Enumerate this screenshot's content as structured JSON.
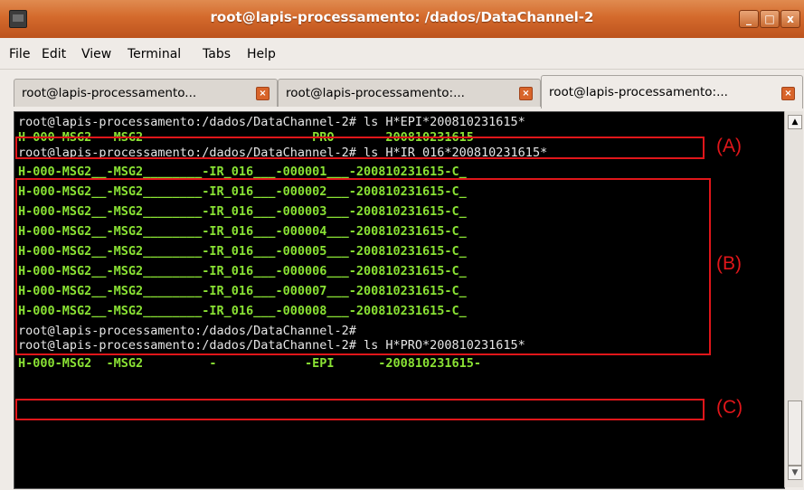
{
  "window": {
    "title": "root@lapis-processamento: /dados/DataChannel-2",
    "controls": {
      "minimize": "_",
      "maximize": "□",
      "close": "x"
    }
  },
  "menu": [
    {
      "label": "File"
    },
    {
      "label": "Edit"
    },
    {
      "label": "View"
    },
    {
      "label": "Terminal"
    },
    {
      "label": "Tabs"
    },
    {
      "label": "Help"
    }
  ],
  "tabs": [
    {
      "label": "root@lapis-processamento...",
      "active": false
    },
    {
      "label": "root@lapis-processamento:...",
      "active": false
    },
    {
      "label": "root@lapis-processamento:...",
      "active": true
    }
  ],
  "terminal": {
    "lines": [
      {
        "type": "prompt",
        "text": "root@lapis-processamento:/dados/DataChannel-2# ls H*EPI*200810231615*"
      },
      {
        "type": "output",
        "text": "H-000-MSG2  -MSG2         -            -PRO      -200810231615-"
      },
      {
        "type": "prompt",
        "text": "root@lapis-processamento:/dados/DataChannel-2# ls H*IR_016*200810231615*"
      },
      {
        "type": "output",
        "text": "H-000-MSG2__-MSG2________-IR_016___-000001___-200810231615-C_"
      },
      {
        "type": "output",
        "text": "H-000-MSG2__-MSG2________-IR_016___-000002___-200810231615-C_"
      },
      {
        "type": "output",
        "text": "H-000-MSG2__-MSG2________-IR_016___-000003___-200810231615-C_"
      },
      {
        "type": "output",
        "text": "H-000-MSG2__-MSG2________-IR_016___-000004___-200810231615-C_"
      },
      {
        "type": "output",
        "text": "H-000-MSG2__-MSG2________-IR_016___-000005___-200810231615-C_"
      },
      {
        "type": "output",
        "text": "H-000-MSG2__-MSG2________-IR_016___-000006___-200810231615-C_"
      },
      {
        "type": "output",
        "text": "H-000-MSG2__-MSG2________-IR_016___-000007___-200810231615-C_"
      },
      {
        "type": "output",
        "text": "H-000-MSG2__-MSG2________-IR_016___-000008___-200810231615-C_"
      },
      {
        "type": "prompt",
        "text": "root@lapis-processamento:/dados/DataChannel-2#"
      },
      {
        "type": "prompt",
        "text": "root@lapis-processamento:/dados/DataChannel-2# ls H*PRO*200810231615*"
      },
      {
        "type": "output",
        "text": "H-000-MSG2  -MSG2         -            -EPI      -200810231615-"
      }
    ]
  },
  "annotations": [
    {
      "label": "(A)"
    },
    {
      "label": "(B)"
    },
    {
      "label": "(C)"
    }
  ],
  "colors": {
    "titlebar": "#d46a2c",
    "terminal_bg": "#000000",
    "output_text": "#8ae234",
    "prompt_text": "#e6e6e6",
    "annotation": "#e0161a"
  }
}
